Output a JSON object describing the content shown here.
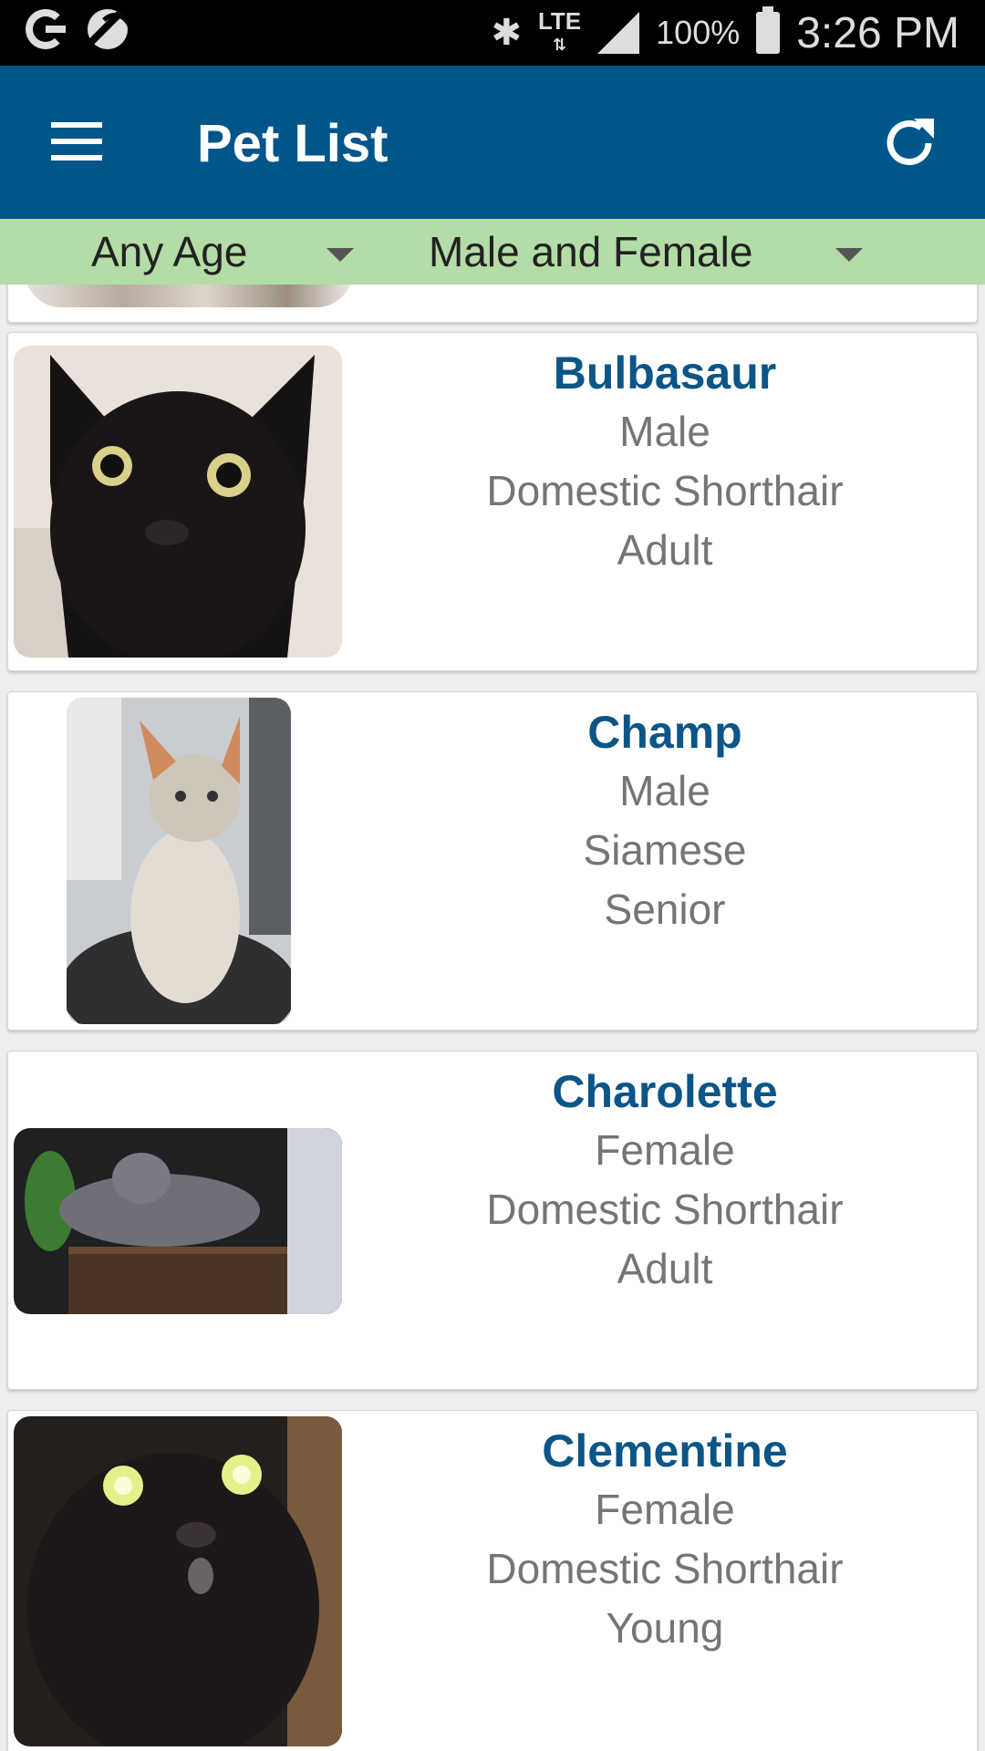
{
  "status_bar": {
    "battery": "100%",
    "time": "3:26 PM",
    "network": "LTE",
    "icons": [
      "google-icon",
      "sports-ball-icon",
      "bluetooth-icon",
      "lte-icon",
      "signal-icon",
      "battery-icon"
    ]
  },
  "app_bar": {
    "title": "Pet List",
    "background_color": "#00568a",
    "icons": [
      "menu-icon",
      "refresh-icon"
    ]
  },
  "filters": {
    "age": "Any Age",
    "sex": "Male and Female",
    "background_color": "#b4dca6"
  },
  "pets": [
    {
      "name": "Bulbasaur",
      "sex": "Male",
      "breed": "Domestic Shorthair",
      "age": "Adult"
    },
    {
      "name": "Champ",
      "sex": "Male",
      "breed": "Siamese",
      "age": "Senior"
    },
    {
      "name": "Charolette",
      "sex": "Female",
      "breed": "Domestic Shorthair",
      "age": "Adult"
    },
    {
      "name": "Clementine",
      "sex": "Female",
      "breed": "Domestic Shorthair",
      "age": "Young"
    }
  ]
}
